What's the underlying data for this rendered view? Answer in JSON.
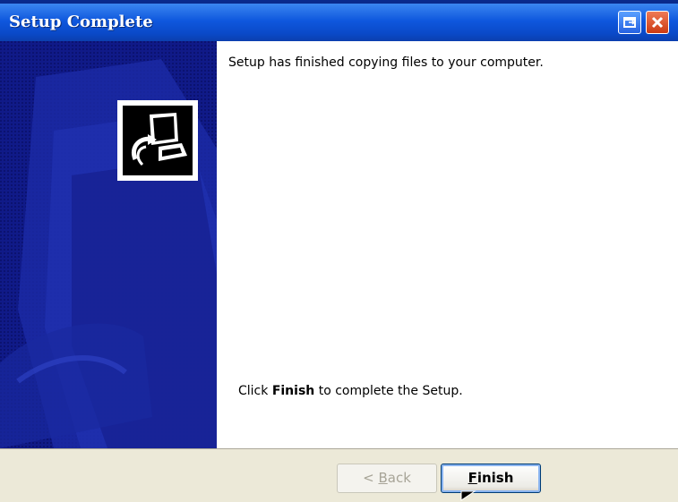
{
  "window": {
    "title": "Setup Complete"
  },
  "content": {
    "top_message": "Setup has finished copying files to your computer.",
    "bottom_prefix": "Click ",
    "bottom_bold": "Finish",
    "bottom_suffix": " to complete the Setup."
  },
  "footer": {
    "back_prefix": "< ",
    "back_hotkey": "B",
    "back_rest": "ack",
    "finish_hotkey": "F",
    "finish_rest": "inish"
  },
  "colors": {
    "titlebar": "#0f58de",
    "side_panel": "#0f1b85",
    "content_bg": "#ffffff",
    "footer_bg": "#ece9d8"
  },
  "icons": {
    "restore": "restore-icon",
    "close": "close-icon",
    "setup": "computer-setup-icon"
  }
}
